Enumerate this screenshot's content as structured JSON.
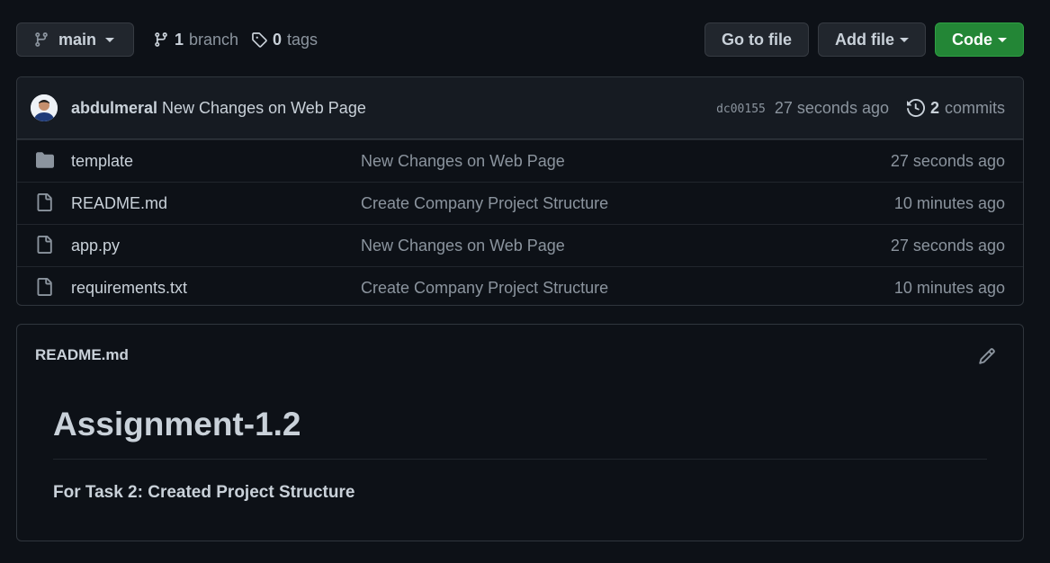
{
  "toolbar": {
    "branch_name": "main",
    "branch_count": "1",
    "branch_label": "branch",
    "tag_count": "0",
    "tag_label": "tags",
    "goto_file_label": "Go to file",
    "add_file_label": "Add file",
    "code_label": "Code"
  },
  "latest_commit": {
    "author": "abdulmeral",
    "message": "New Changes on Web Page",
    "sha": "dc00155",
    "age": "27 seconds ago",
    "commit_count": "2",
    "commit_label": "commits"
  },
  "files": [
    {
      "name": "template",
      "type": "folder",
      "message": "New Changes on Web Page",
      "age": "27 seconds ago"
    },
    {
      "name": "README.md",
      "type": "file",
      "message": "Create Company Project Structure",
      "age": "10 minutes ago"
    },
    {
      "name": "app.py",
      "type": "file",
      "message": "New Changes on Web Page",
      "age": "27 seconds ago"
    },
    {
      "name": "requirements.txt",
      "type": "file",
      "message": "Create Company Project Structure",
      "age": "10 minutes ago"
    }
  ],
  "readme": {
    "title": "README.md",
    "heading": "Assignment-1.2",
    "paragraph": "For Task 2: Created Project Structure"
  },
  "colors": {
    "background": "#0d1117",
    "code_button": "#238636",
    "muted_text": "#8b949e"
  }
}
